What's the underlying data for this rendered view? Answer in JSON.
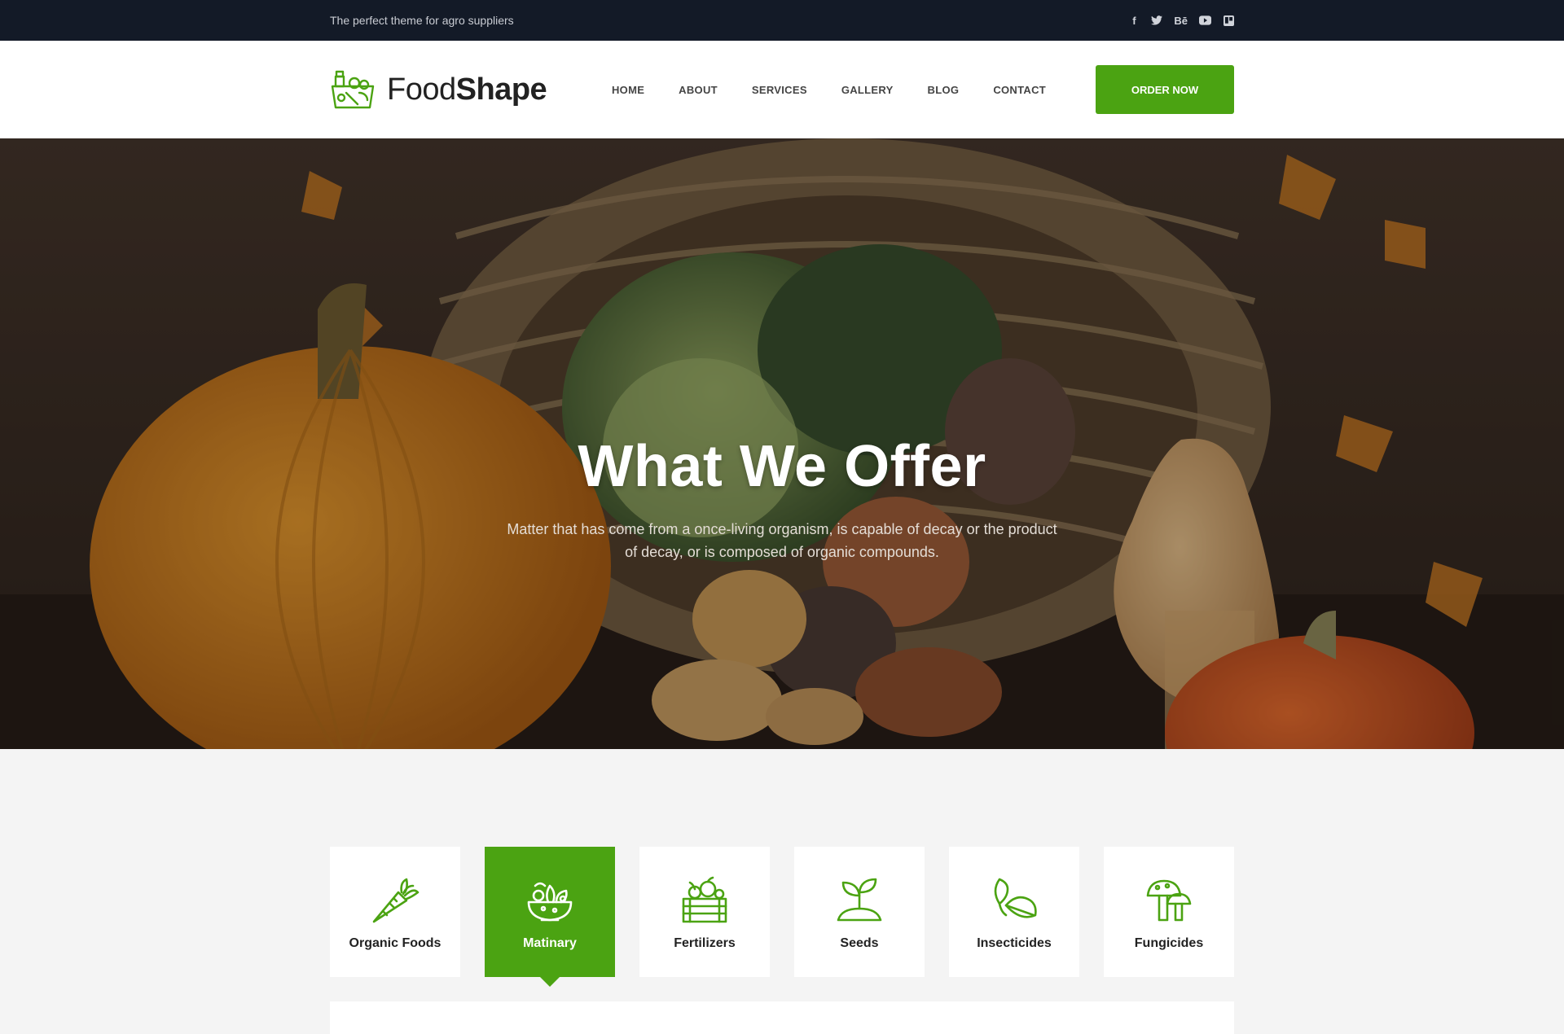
{
  "topbar": {
    "tagline": "The perfect theme for agro suppliers",
    "social": [
      {
        "name": "facebook-icon",
        "glyph": "f"
      },
      {
        "name": "twitter-icon",
        "glyph": "🐦"
      },
      {
        "name": "behance-icon",
        "glyph": "Bē"
      },
      {
        "name": "youtube-icon",
        "glyph": "▶"
      },
      {
        "name": "trello-icon",
        "glyph": "▥"
      }
    ]
  },
  "header": {
    "logo_light": "Food",
    "logo_bold": "Shape",
    "nav": [
      "HOME",
      "ABOUT",
      "SERVICES",
      "GALLERY",
      "BLOG",
      "CONTACT"
    ],
    "cta": "ORDER NOW"
  },
  "hero": {
    "title": "What We Offer",
    "subtitle": "Matter that has come from a once-living organism, is capable of decay or the product of decay, or is composed of organic compounds."
  },
  "services": {
    "items": [
      {
        "label": "Organic Foods",
        "icon": "carrot-icon",
        "active": false
      },
      {
        "label": "Matinary",
        "icon": "salad-bowl-icon",
        "active": true
      },
      {
        "label": "Fertilizers",
        "icon": "crate-icon",
        "active": false
      },
      {
        "label": "Seeds",
        "icon": "sprout-icon",
        "active": false
      },
      {
        "label": "Insecticides",
        "icon": "leaf-icon",
        "active": false
      },
      {
        "label": "Fungicides",
        "icon": "mushroom-icon",
        "active": false
      }
    ]
  },
  "colors": {
    "accent": "#4ba312",
    "topbar": "#131a27"
  }
}
